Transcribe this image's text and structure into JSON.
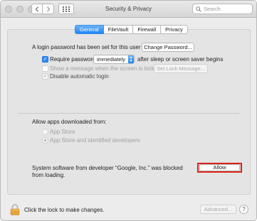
{
  "window": {
    "title": "Security & Privacy"
  },
  "toolbar": {
    "back_icon": "chevron-left-icon",
    "forward_icon": "chevron-right-icon",
    "grid_icon": "show-all-grid-icon"
  },
  "search": {
    "placeholder": "Search",
    "value": ""
  },
  "tabs": [
    {
      "label": "General",
      "active": true
    },
    {
      "label": "FileVault",
      "active": false
    },
    {
      "label": "Firewall",
      "active": false
    },
    {
      "label": "Privacy",
      "active": false
    }
  ],
  "general": {
    "login_password_text": "A login password has been set for this user",
    "change_password_label": "Change Password...",
    "require_password": {
      "label": "Require password",
      "checked": true,
      "select_value": "immediately",
      "suffix": "after sleep or screen saver begins"
    },
    "show_message": {
      "label": "Show a message when the screen is locked",
      "checked": false,
      "enabled": false,
      "button_label": "Set Lock Message..."
    },
    "disable_auto_login": {
      "label": "Disable automatic login",
      "checked": true,
      "enabled": false
    }
  },
  "downloads": {
    "heading": "Allow apps downloaded from:",
    "options": [
      {
        "label": "App Store",
        "selected": false
      },
      {
        "label": "App Store and identified developers",
        "selected": true
      }
    ]
  },
  "blocked": {
    "line1": "System software from developer “Google, Inc.” was blocked",
    "line2": "from loading.",
    "allow_label": "Allow"
  },
  "footer": {
    "lock_text": "Click the lock to make changes.",
    "advanced_label": "Advanced...",
    "help_label": "?"
  },
  "colors": {
    "accent": "#1e86f5",
    "highlight": "#d9241b",
    "window_bg": "#ececec"
  }
}
